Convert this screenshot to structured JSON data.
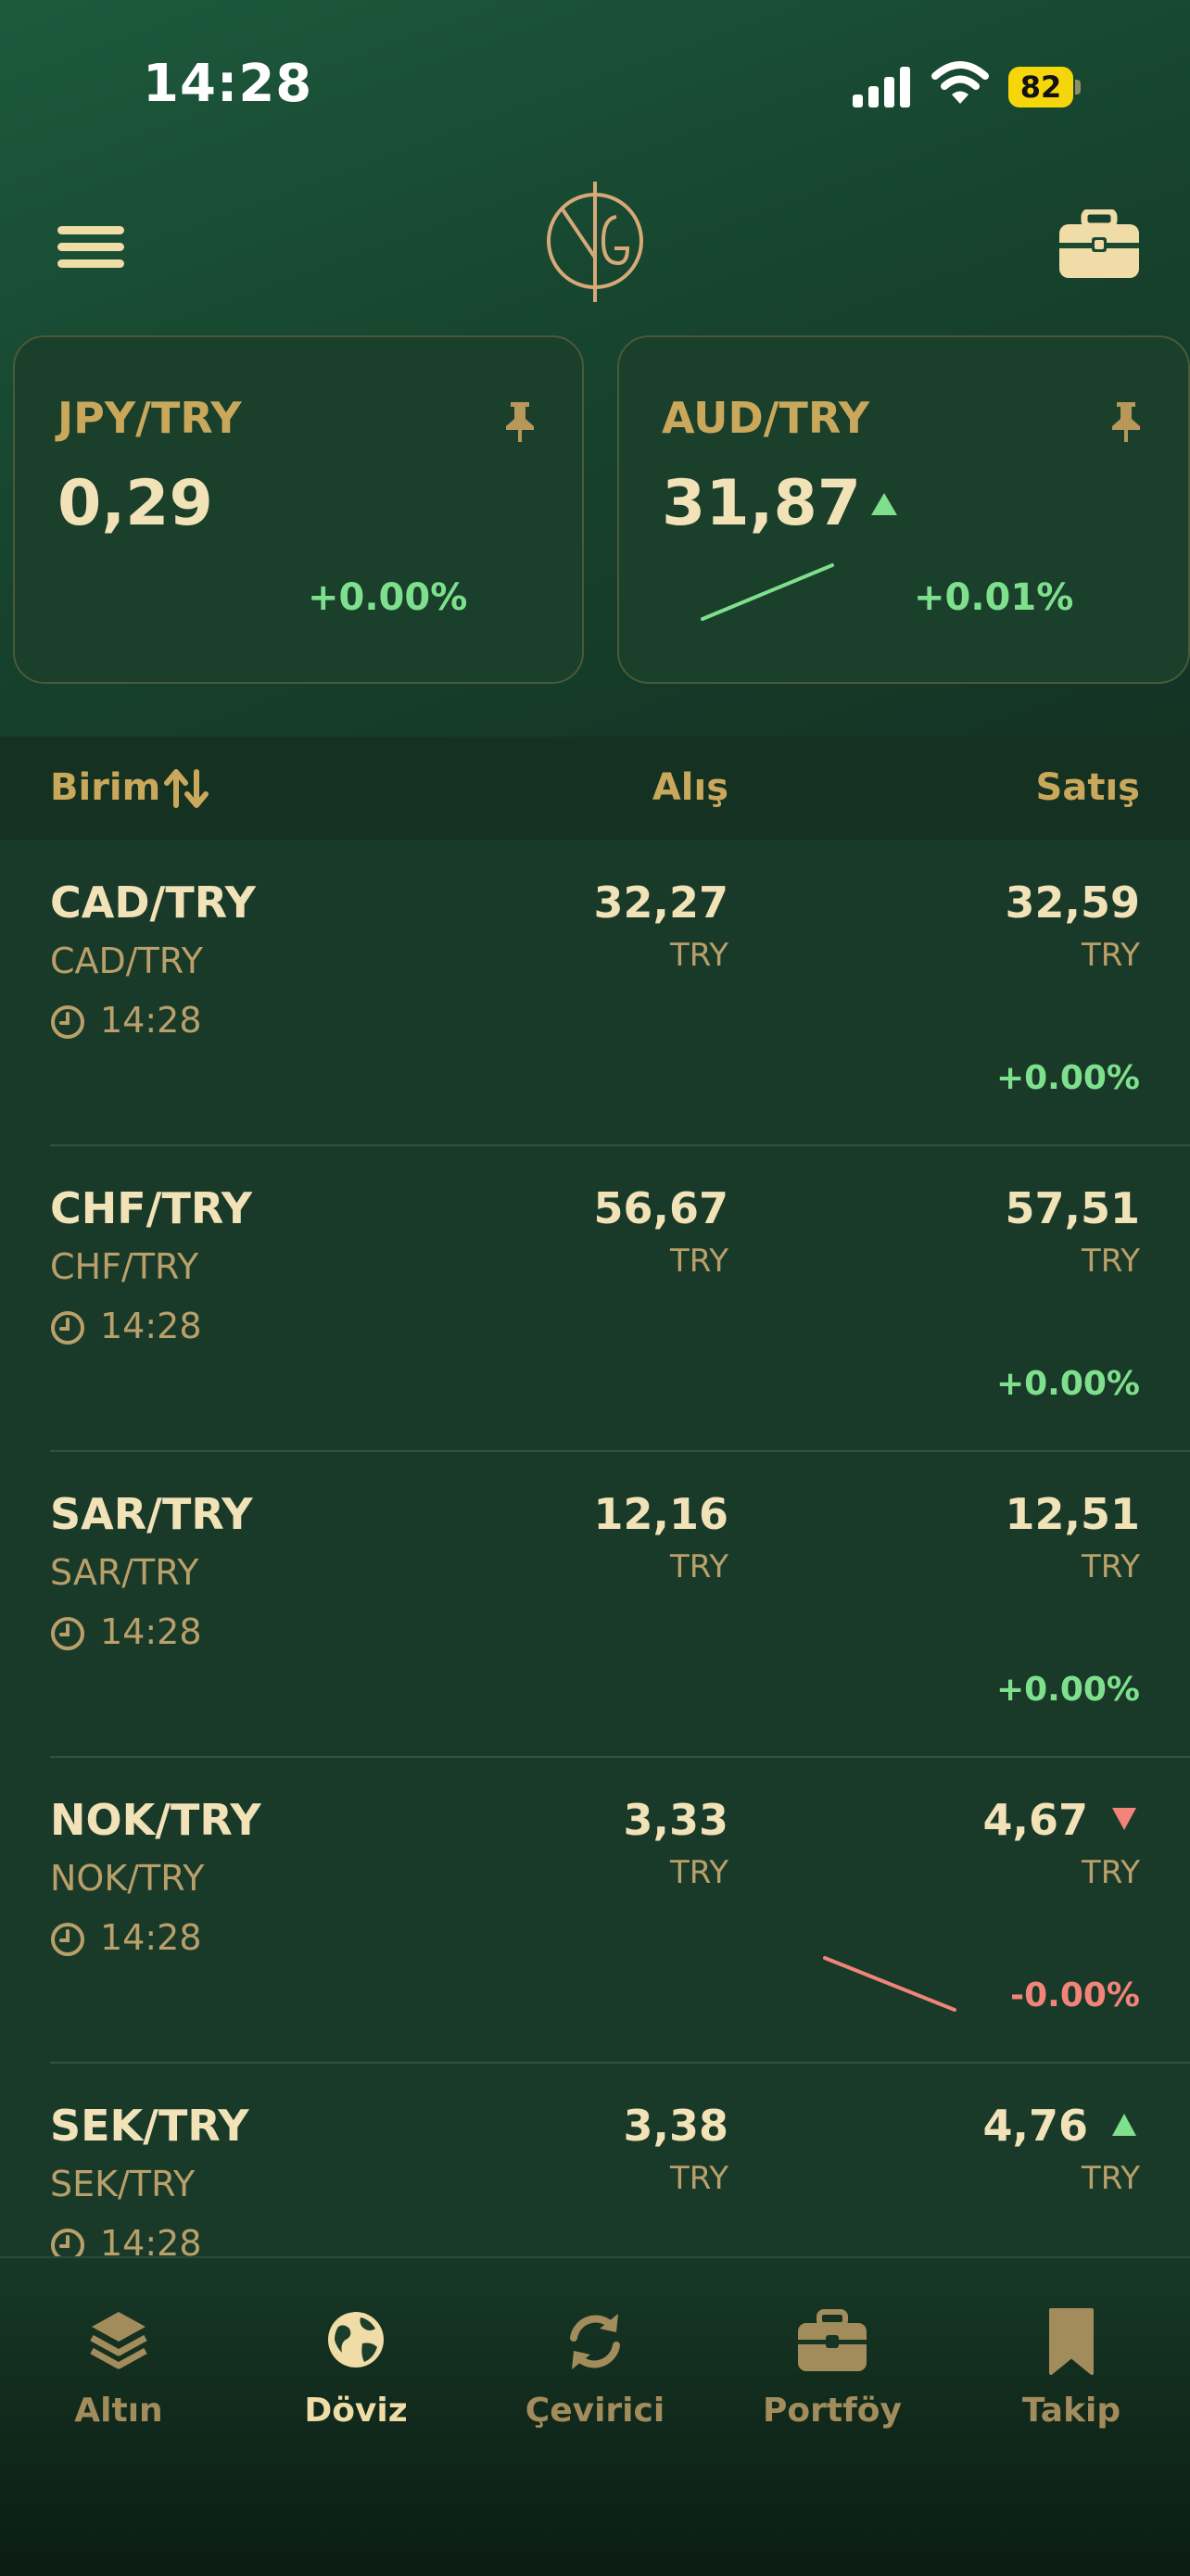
{
  "status_bar": {
    "time": "14:28",
    "battery": "82"
  },
  "header": {
    "menu_icon": "hamburger-menu-icon",
    "logo_icon": "yg-monogram-logo",
    "portfolio_icon": "briefcase-icon"
  },
  "pinned_cards": [
    {
      "symbol": "JPY/TRY",
      "value": "0,29",
      "change": "+0.00%",
      "trend": "flat",
      "pin_icon": "pin-icon"
    },
    {
      "symbol": "AUD/TRY",
      "value": "31,87",
      "change": "+0.01%",
      "trend": "up",
      "pin_icon": "pin-icon"
    }
  ],
  "table_header": {
    "unit": "Birim",
    "buy": "Alış",
    "sell": "Satış"
  },
  "rows": [
    {
      "name": "CAD/TRY",
      "sub": "CAD/TRY",
      "time": "14:28",
      "buy": "32,27",
      "buy_currency": "TRY",
      "sell": "32,59",
      "sell_currency": "TRY",
      "change": "+0.00%",
      "trend": "flat"
    },
    {
      "name": "CHF/TRY",
      "sub": "CHF/TRY",
      "time": "14:28",
      "buy": "56,67",
      "buy_currency": "TRY",
      "sell": "57,51",
      "sell_currency": "TRY",
      "change": "+0.00%",
      "trend": "flat"
    },
    {
      "name": "SAR/TRY",
      "sub": "SAR/TRY",
      "time": "14:28",
      "buy": "12,16",
      "buy_currency": "TRY",
      "sell": "12,51",
      "sell_currency": "TRY",
      "change": "+0.00%",
      "trend": "flat"
    },
    {
      "name": "NOK/TRY",
      "sub": "NOK/TRY",
      "time": "14:28",
      "buy": "3,33",
      "buy_currency": "TRY",
      "sell": "4,67",
      "sell_currency": "TRY",
      "change": "-0.00%",
      "trend": "down"
    },
    {
      "name": "SEK/TRY",
      "sub": "SEK/TRY",
      "time": "14:28",
      "buy": "3,38",
      "buy_currency": "TRY",
      "sell": "4,76",
      "sell_currency": "TRY",
      "change": "",
      "trend": "up"
    }
  ],
  "tabs": [
    {
      "label": "Altın",
      "icon": "layers-icon",
      "active": false
    },
    {
      "label": "Döviz",
      "icon": "globe-icon",
      "active": true
    },
    {
      "label": "Çevirici",
      "icon": "refresh-icon",
      "active": false
    },
    {
      "label": "Portföy",
      "icon": "briefcase-icon",
      "active": false
    },
    {
      "label": "Takip",
      "icon": "bookmark-icon",
      "active": false
    }
  ],
  "colors": {
    "gold": "#c9a85c",
    "cream": "#f1e2b8",
    "up": "#7ee08c",
    "down": "#f2847a",
    "background": "#1a3a29"
  }
}
